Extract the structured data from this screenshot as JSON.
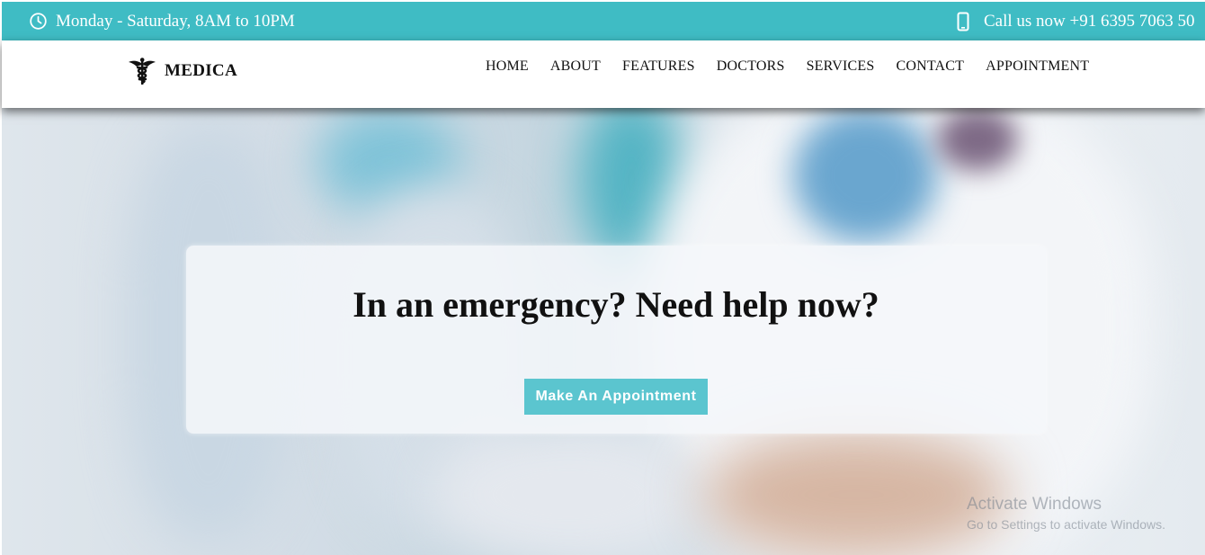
{
  "topbar": {
    "hours": "Monday - Saturday, 8AM to 10PM",
    "hours_icon": "clock-icon",
    "call": "Call us now +91 6395 7063 50",
    "call_icon": "mobile-phone-icon",
    "background": "#3fbcc4"
  },
  "navbar": {
    "brand": "MEDICA",
    "brand_icon": "caduceus-icon",
    "items": [
      {
        "label": "HOME"
      },
      {
        "label": "ABOUT"
      },
      {
        "label": "FEATURES"
      },
      {
        "label": "DOCTORS"
      },
      {
        "label": "SERVICES"
      },
      {
        "label": "CONTACT"
      },
      {
        "label": "APPOINTMENT"
      }
    ]
  },
  "hero": {
    "heading": "In an emergency? Need help now?",
    "cta": "Make An Appointment",
    "cta_color": "#5bc5cf"
  },
  "watermark": {
    "title": "Activate Windows",
    "subtitle": "Go to Settings to activate Windows."
  }
}
